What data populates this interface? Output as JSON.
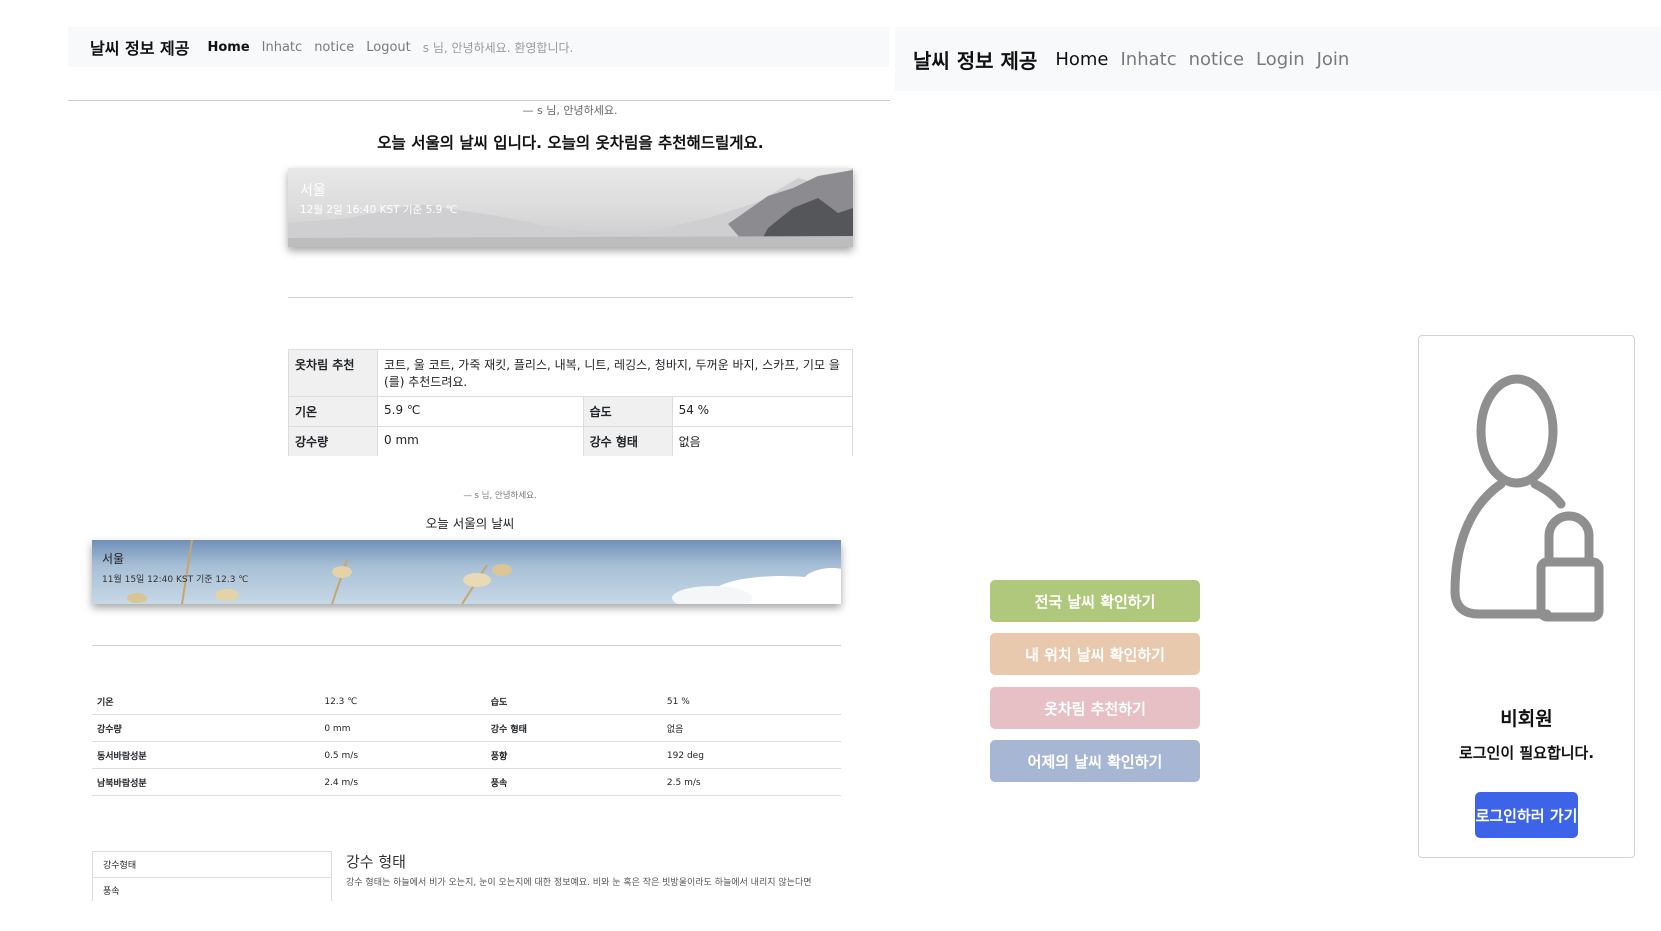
{
  "left_app": {
    "nav": {
      "brand": "날씨 정보 제공",
      "links": [
        "Home",
        "Inhatc",
        "notice",
        "Logout"
      ],
      "greeting": "s 님, 안녕하세요. 환영합니다."
    },
    "greeting_small": "— s 님, 안녕하세요.",
    "headline": "오늘 서울의 날씨 입니다. 오늘의 옷차림을 추천해드릴게요.",
    "banner": {
      "city": "서울",
      "subtitle": "12월 2일   16:40 KST 기준 5.9 ℃"
    },
    "table": {
      "outfit_label": "옷차림 추천",
      "outfit_value": "코트, 울 코트, 가죽 재킷, 플리스, 내복, 니트, 레깅스, 청바지, 두꺼운 바지, 스카프, 기모 을(를) 추천드려요.",
      "temp_label": "기온",
      "temp_value": "5.9 ℃",
      "humidity_label": "습도",
      "humidity_value": "54 %",
      "precip_label": "강수량",
      "precip_value": "0 mm",
      "precip_type_label": "강수 형태",
      "precip_type_value": "없음"
    },
    "section2": {
      "greeting_small": "— s 님, 안녕하세요.",
      "headline": "오늘 서울의 날씨",
      "banner": {
        "city": "서울",
        "subtitle": "11월 15일    12:40 KST 기준 12.3 ℃"
      },
      "rows": [
        [
          "기온",
          "12.3 ℃",
          "습도",
          "51 %"
        ],
        [
          "강수량",
          "0 mm",
          "강수 형태",
          "없음"
        ],
        [
          "동서바람성분",
          "0.5 m/s",
          "풍향",
          "192 deg"
        ],
        [
          "남북바람성분",
          "2.4 m/s",
          "풍속",
          "2.5 m/s"
        ]
      ],
      "side_list": [
        "강수형태",
        "풍속"
      ],
      "detail_title": "강수 형태",
      "detail_text": "강수 형태는 하늘에서 비가 오는지, 눈이 오는지에 대한 정보예요. 비와 눈 혹은 작은 빗방울이라도 하늘에서 내리지 않는다면"
    }
  },
  "right_app": {
    "nav": {
      "brand": "날씨 정보 제공",
      "links": [
        "Home",
        "Inhatc",
        "notice",
        "Login",
        "Join"
      ]
    },
    "menu_buttons": [
      {
        "label": "전국 날씨 확인하기",
        "color": "#b0c87c"
      },
      {
        "label": "내 위치 날씨 확인하기",
        "color": "#e8c9ae"
      },
      {
        "label": "옷차림 추천하기",
        "color": "#e6c0c4"
      },
      {
        "label": "어제의 날씨 확인하기",
        "color": "#a7b6d3"
      }
    ],
    "login_card": {
      "icon": "user-lock-icon",
      "title": "비회원",
      "message": "로그인이 필요합니다.",
      "button": "로그인하러 가기"
    }
  }
}
